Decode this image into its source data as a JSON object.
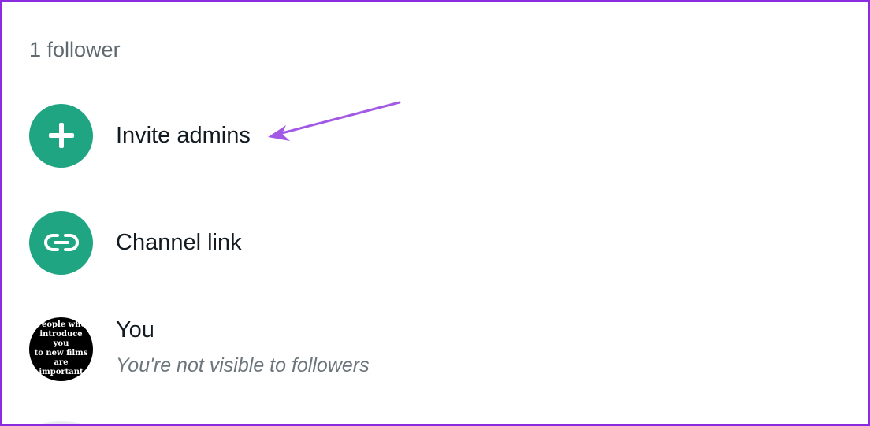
{
  "header": {
    "follower_count": "1 follower"
  },
  "actions": [
    {
      "label": "Invite admins",
      "icon": "plus-icon"
    },
    {
      "label": "Channel link",
      "icon": "link-icon"
    }
  ],
  "you": {
    "name": "You",
    "subtitle": "You're not visible to followers",
    "avatar_text": [
      "People who",
      "introduce you",
      "to new films",
      "are important"
    ]
  },
  "colors": {
    "accent": "#1fa582",
    "annotation": "#a259e6",
    "frame": "#8a2be2"
  }
}
